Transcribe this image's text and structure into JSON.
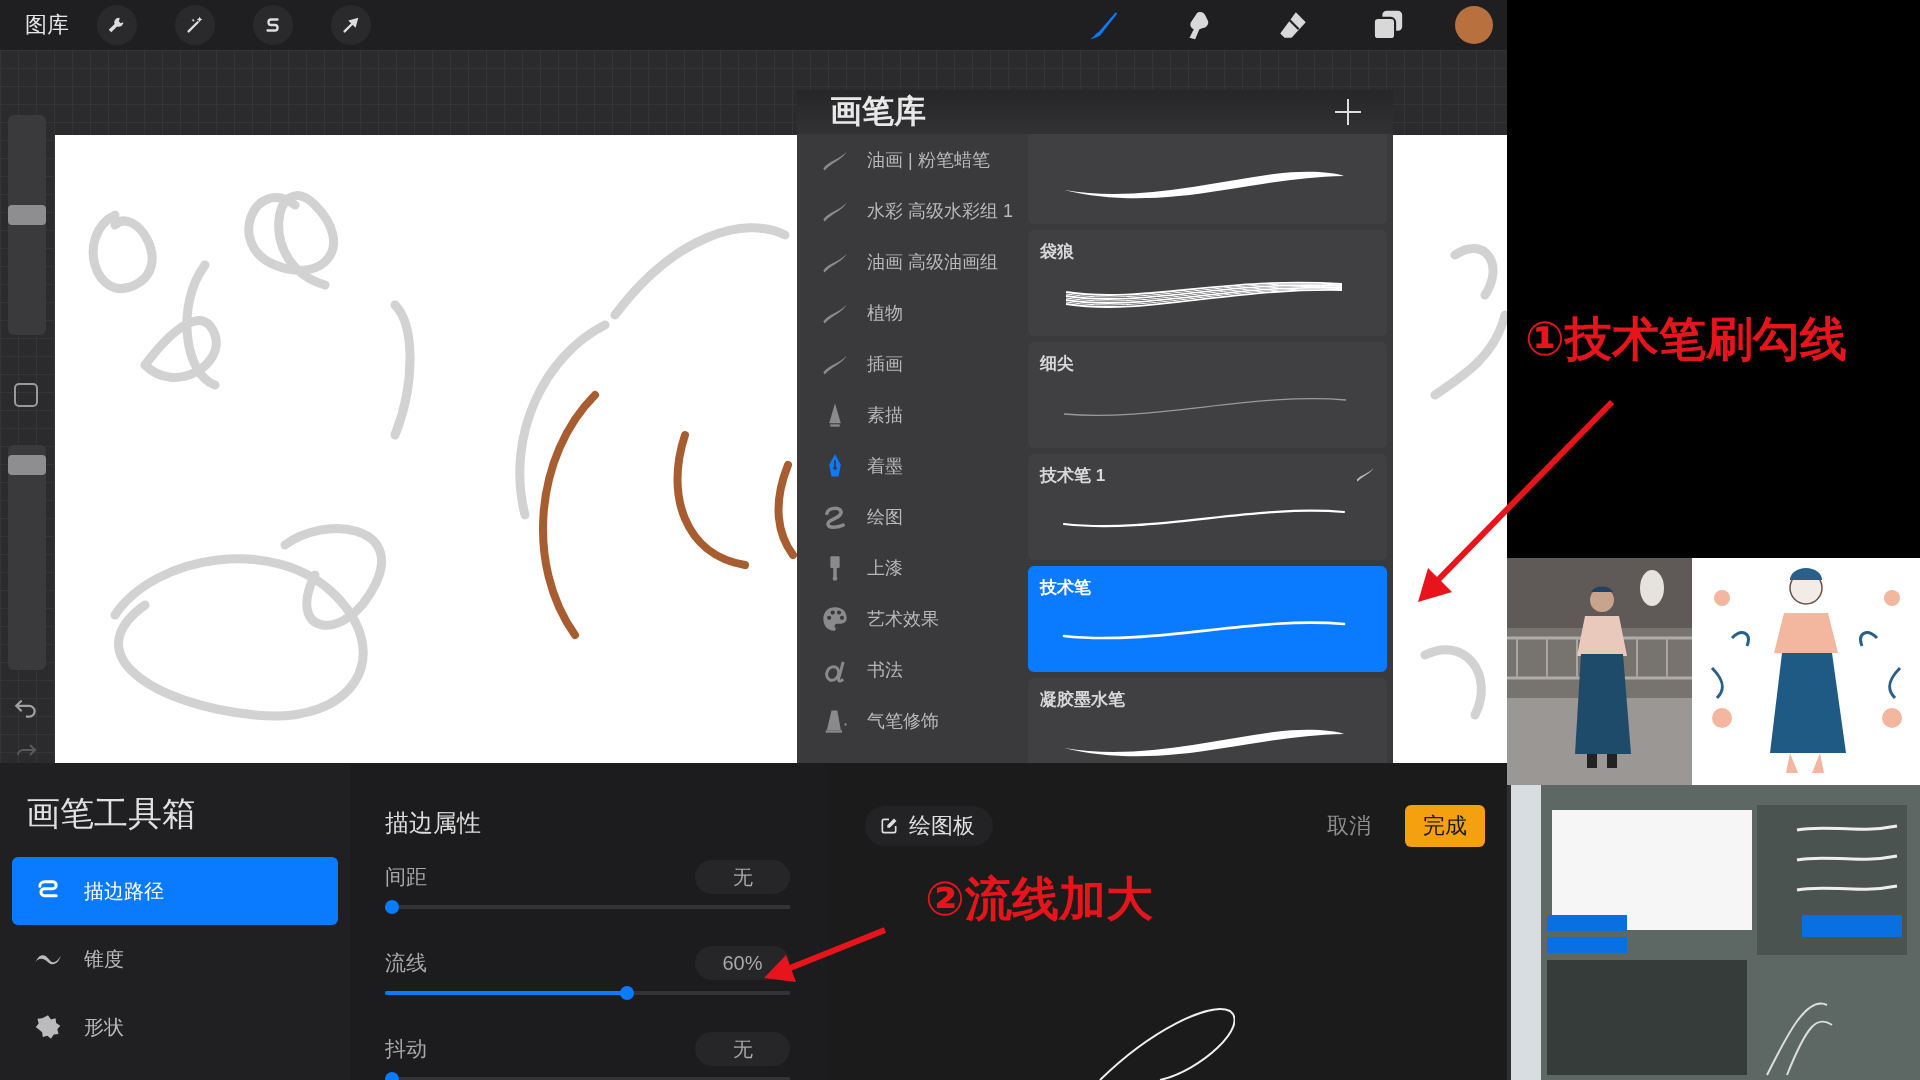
{
  "top_bar": {
    "gallery": "图库",
    "tools": [
      {
        "kind": "wrench"
      },
      {
        "kind": "wand"
      },
      {
        "kind": "selection"
      },
      {
        "kind": "transform"
      }
    ],
    "brush_tools": [
      {
        "kind": "brush",
        "selected": true
      },
      {
        "kind": "smudge",
        "selected": false
      },
      {
        "kind": "eraser",
        "selected": false
      },
      {
        "kind": "layers",
        "selected": false
      }
    ],
    "color_swatch": {
      "color": "#b8703f"
    }
  },
  "side_rail": {
    "size_slider": {
      "level": 0.55
    },
    "opacity_slider": {
      "level": 0.95
    }
  },
  "brush_library": {
    "title": "画笔库",
    "categories": [
      {
        "name": "油画 | 粉笔蜡笔",
        "selected": false
      },
      {
        "name": "水彩 高级水彩组 1",
        "selected": false
      },
      {
        "name": "油画 高级油画组",
        "selected": false
      },
      {
        "name": "植物",
        "selected": false
      },
      {
        "name": "插画",
        "selected": false
      },
      {
        "name": "素描",
        "selected": false
      },
      {
        "name": "着墨",
        "selected": true
      },
      {
        "name": "绘图",
        "selected": false
      },
      {
        "name": "上漆",
        "selected": false
      },
      {
        "name": "艺术效果",
        "selected": false
      },
      {
        "name": "书法",
        "selected": false
      },
      {
        "name": "气笔修饰",
        "selected": false
      }
    ],
    "brushes": [
      {
        "imported": false,
        "selected": false
      },
      {
        "name": "袋狼",
        "imported": false,
        "selected": false
      },
      {
        "name": "细尖",
        "imported": false,
        "selected": false
      },
      {
        "name": "技术笔 1",
        "imported": true,
        "selected": false
      },
      {
        "name": "技术笔",
        "imported": false,
        "selected": true
      },
      {
        "name": "凝胶墨水笔",
        "imported": false,
        "selected": false
      }
    ]
  },
  "toolbox": {
    "title": "画笔工具箱",
    "sections": [
      {
        "label": "描边路径",
        "selected": true
      },
      {
        "label": "锥度",
        "selected": false
      },
      {
        "label": "形状",
        "selected": false
      }
    ]
  },
  "properties": {
    "title": "描边属性",
    "sliders": [
      {
        "label": "间距",
        "reading": "无",
        "level": 0
      },
      {
        "label": "流线",
        "reading": "60%",
        "level": 0.6
      },
      {
        "label": "抖动",
        "reading": "无",
        "level": 0
      }
    ]
  },
  "drawing_pad": {
    "button": "绘图板",
    "cancel": "取消",
    "done": "完成"
  },
  "annotations": [
    {
      "text": "①技术笔刷勾线"
    },
    {
      "text": "②流线加大"
    }
  ]
}
